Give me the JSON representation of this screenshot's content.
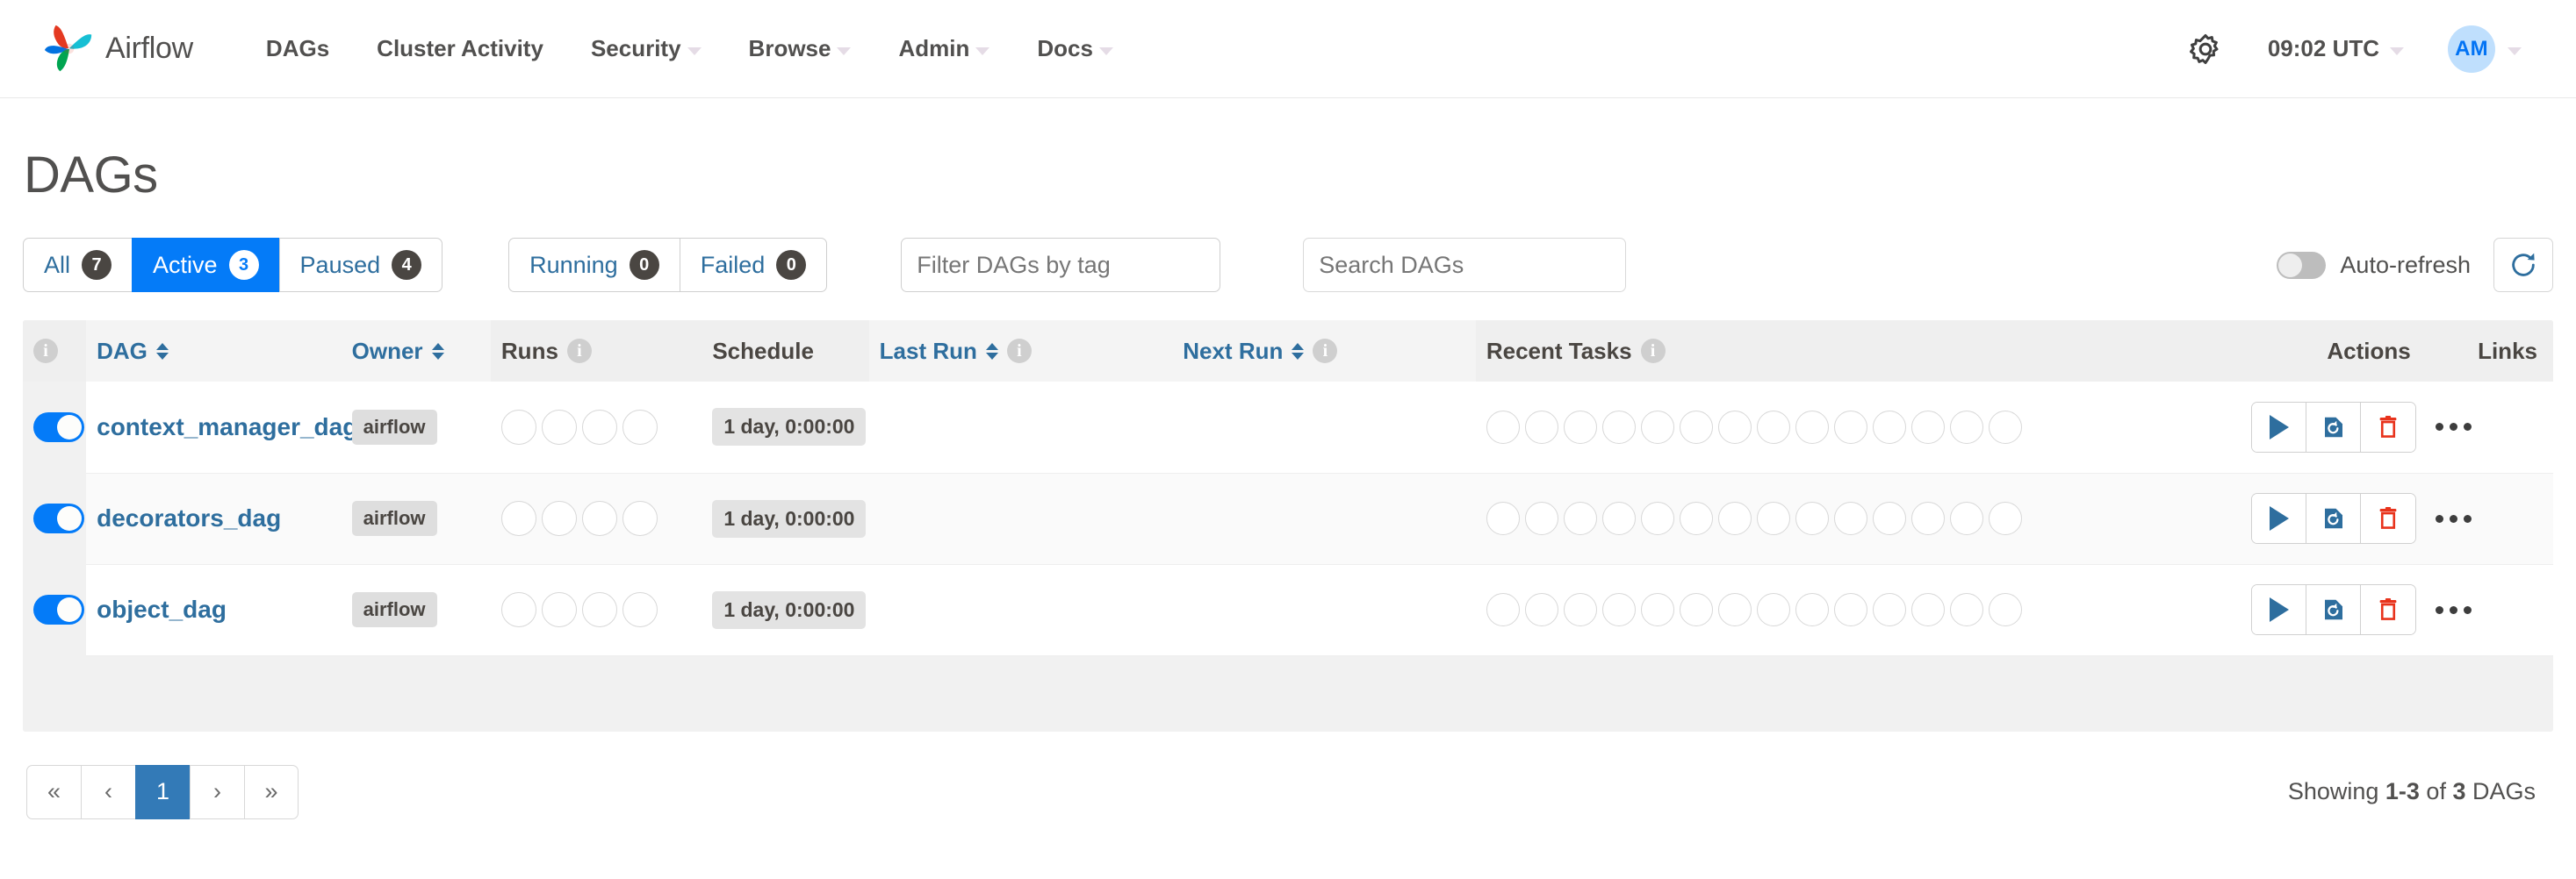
{
  "navbar": {
    "brand": "Airflow",
    "items": [
      {
        "label": "DAGs",
        "caret": false
      },
      {
        "label": "Cluster Activity",
        "caret": false
      },
      {
        "label": "Security",
        "caret": true
      },
      {
        "label": "Browse",
        "caret": true
      },
      {
        "label": "Admin",
        "caret": true
      },
      {
        "label": "Docs",
        "caret": true
      }
    ],
    "gear_icon": "gear-icon",
    "clock": "09:02 UTC",
    "user_initials": "AM"
  },
  "page": {
    "title": "DAGs"
  },
  "toolbar": {
    "status_filters": [
      {
        "label": "All",
        "count": "7",
        "active": false
      },
      {
        "label": "Active",
        "count": "3",
        "active": true
      },
      {
        "label": "Paused",
        "count": "4",
        "active": false
      }
    ],
    "run_filters": [
      {
        "label": "Running",
        "count": "0"
      },
      {
        "label": "Failed",
        "count": "0"
      }
    ],
    "filter_tag_placeholder": "Filter DAGs by tag",
    "filter_tag_value": "",
    "search_placeholder": "Search DAGs",
    "search_value": "",
    "auto_refresh_label": "Auto-refresh",
    "auto_refresh_on": false,
    "refresh_icon": "refresh-icon"
  },
  "table": {
    "columns": [
      {
        "key": "info",
        "label": "",
        "sortable": false,
        "info": true
      },
      {
        "key": "dag",
        "label": "DAG",
        "sortable": true,
        "link": true
      },
      {
        "key": "owner",
        "label": "Owner",
        "sortable": true,
        "link": true
      },
      {
        "key": "runs",
        "label": "Runs",
        "sortable": false,
        "info": true
      },
      {
        "key": "schedule",
        "label": "Schedule",
        "sortable": false
      },
      {
        "key": "last_run",
        "label": "Last Run",
        "sortable": true,
        "link": true,
        "info": true
      },
      {
        "key": "next_run",
        "label": "Next Run",
        "sortable": true,
        "link": true,
        "info": true
      },
      {
        "key": "recent_tasks",
        "label": "Recent Tasks",
        "sortable": false,
        "info": true
      },
      {
        "key": "actions",
        "label": "Actions",
        "sortable": false
      },
      {
        "key": "links",
        "label": "Links",
        "sortable": false
      }
    ],
    "runs_circle_count": 4,
    "recent_tasks_circle_count": 14,
    "action_icons": [
      "trigger-dag-icon",
      "clear-dag-icon",
      "delete-dag-icon"
    ],
    "links_icon": "ellipsis-icon",
    "rows": [
      {
        "enabled": true,
        "name": "context_manager_dag",
        "owner": "airflow",
        "schedule": "1 day, 0:00:00",
        "last_run": "",
        "next_run": ""
      },
      {
        "enabled": true,
        "name": "decorators_dag",
        "owner": "airflow",
        "schedule": "1 day, 0:00:00",
        "last_run": "",
        "next_run": ""
      },
      {
        "enabled": true,
        "name": "object_dag",
        "owner": "airflow",
        "schedule": "1 day, 0:00:00",
        "last_run": "",
        "next_run": ""
      }
    ]
  },
  "footer": {
    "pager": [
      {
        "label": "«",
        "name": "first-page",
        "current": false
      },
      {
        "label": "‹",
        "name": "prev-page",
        "current": false
      },
      {
        "label": "1",
        "name": "page-1",
        "current": true
      },
      {
        "label": "›",
        "name": "next-page",
        "current": false
      },
      {
        "label": "»",
        "name": "last-page",
        "current": false
      }
    ],
    "showing_prefix": "Showing ",
    "showing_range": "1-3",
    "showing_mid": " of ",
    "showing_total": "3",
    "showing_suffix": " DAGs"
  },
  "colors": {
    "accent_blue": "#047bf8",
    "link_blue": "#2e6e9e",
    "pager_blue": "#337ab7",
    "danger_red": "#e8331c",
    "badge_gray": "#4a4642"
  }
}
